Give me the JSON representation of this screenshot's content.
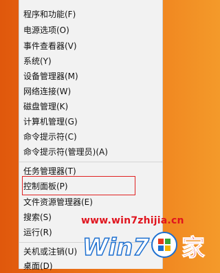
{
  "menu": {
    "items": [
      "程序和功能(F)",
      "电源选项(O)",
      "事件查看器(V)",
      "系统(Y)",
      "设备管理器(M)",
      "网络连接(W)",
      "磁盘管理(K)",
      "计算机管理(G)",
      "命令提示符(C)",
      "命令提示符(管理员)(A)",
      "任务管理器(T)",
      "控制面板(P)",
      "文件资源管理器(E)",
      "搜索(S)",
      "运行(R)",
      "关机或注销(U)",
      "桌面(D)"
    ],
    "highlighted_item": "控制面板(P)"
  },
  "watermark": {
    "url": "www.win7zhijia.cn",
    "logo_text": "Win7",
    "logo_char": "家"
  },
  "colors": {
    "highlight_border": "#e02020",
    "watermark_red": "#e0141e",
    "logo_blue": "#1c6fd0"
  }
}
